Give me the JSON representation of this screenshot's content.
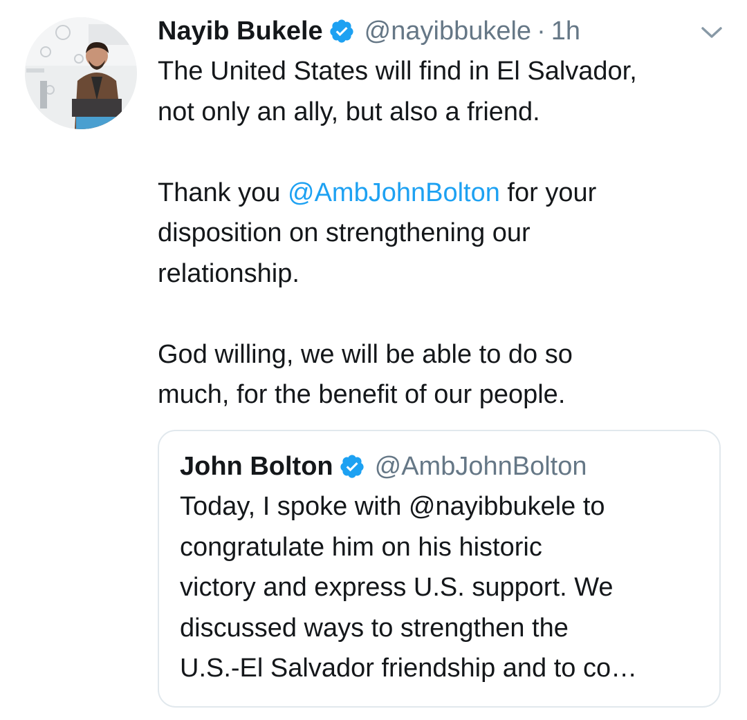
{
  "tweet": {
    "author": {
      "name": "Nayib Bukele",
      "handle": "@nayibbukele",
      "verified": true
    },
    "separator": "·",
    "time": "1h",
    "body": {
      "line1": "The United States will find in El Salvador,",
      "line2": "not only an ally, but also a friend.",
      "para2_pre": "Thank you ",
      "para2_mention": "@AmbJohnBolton",
      "para2_post": " for your",
      "line4": "disposition on strengthening our",
      "line5": "relationship.",
      "line6": "God willing, we will be able to do so",
      "line7": "much, for the benefit of our people."
    },
    "quoted": {
      "name": "John Bolton",
      "handle": "@AmbJohnBolton",
      "verified": true,
      "lines": [
        "Today, I spoke with @nayibbukele to",
        "congratulate him on his historic",
        "victory and express U.S. support. We",
        "discussed ways to strengthen the",
        "U.S.-El Salvador friendship and to co…"
      ]
    }
  },
  "icons": {
    "verified": "verified-badge-icon",
    "caret": "chevron-down-icon"
  },
  "colors": {
    "text": "#14171a",
    "secondary": "#657786",
    "link": "#1da1f2",
    "border": "#e1e8ed"
  }
}
